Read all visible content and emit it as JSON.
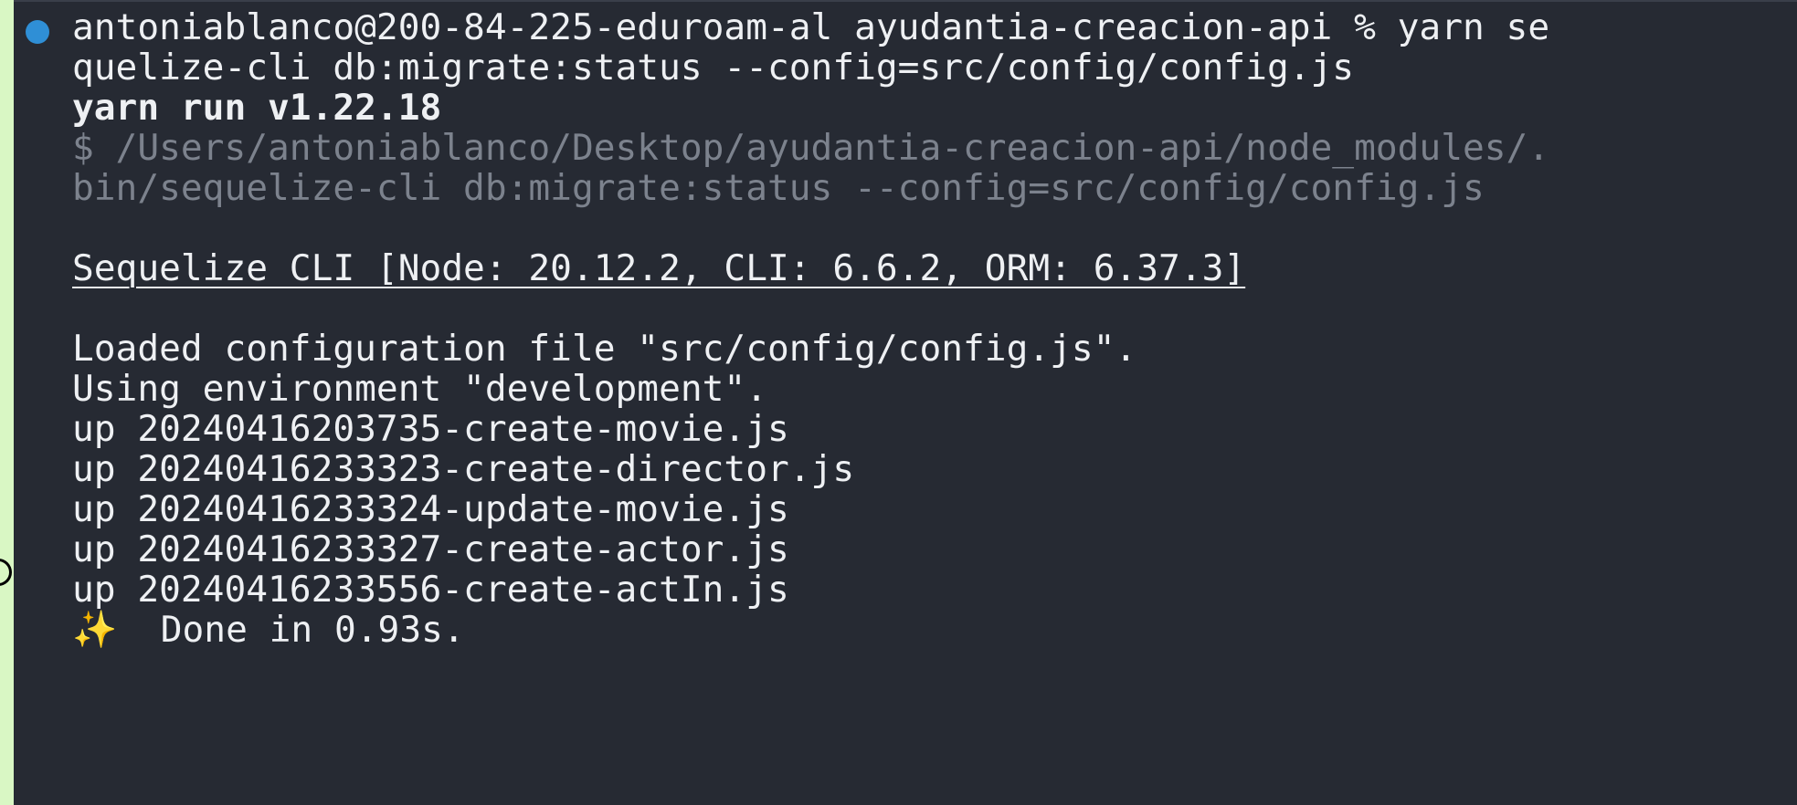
{
  "terminal": {
    "prompt_line": "antoniablanco@200-84-225-eduroam-al ayudantia-creacion-api % yarn se",
    "prompt_continuation": "quelize-cli db:migrate:status --config=src/config/config.js",
    "yarn_header": "yarn run v1.22.18",
    "exec_path_1": "$ /Users/antoniablanco/Desktop/ayudantia-creacion-api/node_modules/.",
    "exec_path_2": "bin/sequelize-cli db:migrate:status --config=src/config/config.js",
    "sequelize_banner": "Sequelize CLI [Node: 20.12.2, CLI: 6.6.2, ORM: 6.37.3]",
    "loaded_config": "Loaded configuration file \"src/config/config.js\".",
    "using_env": "Using environment \"development\".",
    "migrations": [
      "up 20240416203735-create-movie.js",
      "up 20240416233323-create-director.js",
      "up 20240416233324-update-movie.js",
      "up 20240416233327-create-actor.js",
      "up 20240416233556-create-actIn.js"
    ],
    "done_icon": "✨",
    "done_text": "Done in 0.93s."
  },
  "colors": {
    "background": "#262a33",
    "text": "#eef0f3",
    "dim_text": "#7c828d",
    "prompt_dot": "#2f8fd6",
    "outer_bg": "#d9f7c4"
  }
}
